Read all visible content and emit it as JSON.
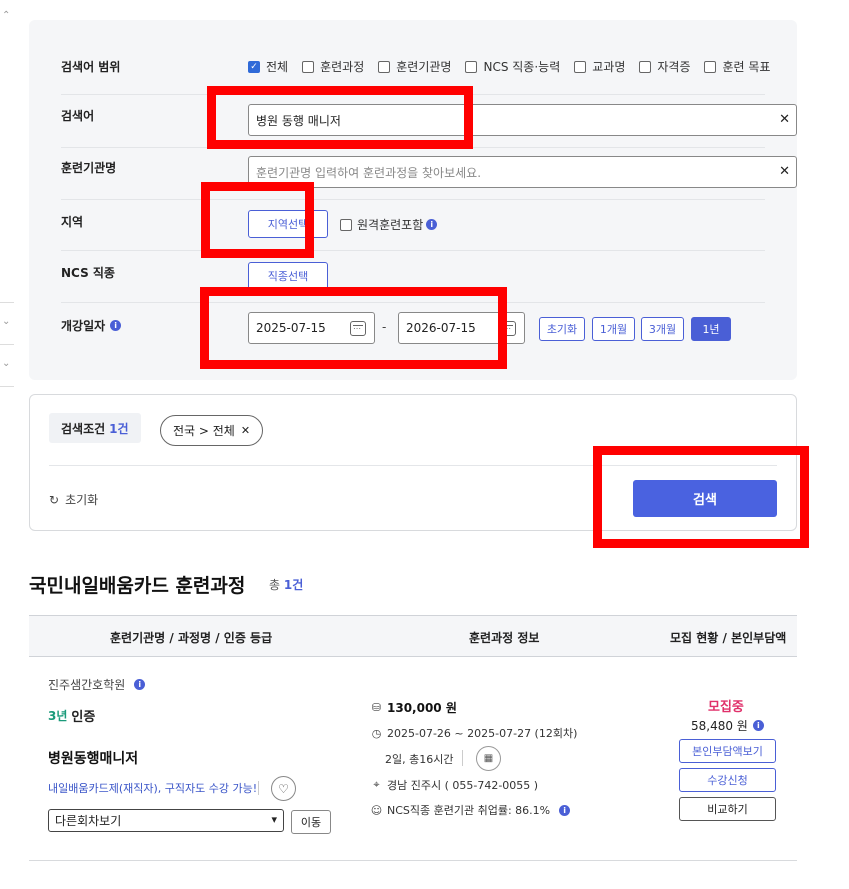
{
  "search": {
    "scope_label": "검색어 범위",
    "scope_options": [
      {
        "label": "전체",
        "checked": true
      },
      {
        "label": "훈련과정",
        "checked": false
      },
      {
        "label": "훈련기관명",
        "checked": false
      },
      {
        "label": "NCS 직종·능력",
        "checked": false
      },
      {
        "label": "교과명",
        "checked": false
      },
      {
        "label": "자격증",
        "checked": false
      },
      {
        "label": "훈련 목표",
        "checked": false
      }
    ],
    "keyword_label": "검색어",
    "keyword_value": "병원 동행 매니저",
    "institution_label": "훈련기관명",
    "institution_placeholder": "훈련기관명 입력하여 훈련과정을 찾아보세요.",
    "region_label": "지역",
    "region_button": "지역선택",
    "remote_label": "원격훈련포함",
    "ncs_label": "NCS 직종",
    "ncs_button": "직종선택",
    "date_label": "개강일자",
    "date_from": "2025-07-15",
    "date_to": "2026-07-15",
    "date_sep": "-",
    "period_buttons": [
      "초기화",
      "1개월",
      "3개월",
      "1년"
    ],
    "active_period": "1년"
  },
  "conditions": {
    "label": "검색조건",
    "count": "1건",
    "chip": "전국 > 전체",
    "reset": "초기화",
    "search_button": "검색"
  },
  "results": {
    "title": "국민내일배움카드 훈련과정",
    "total_prefix": "총",
    "total_count": "1건",
    "columns": [
      "훈련기관명 / 과정명 / 인증 등급",
      "훈련과정 정보",
      "모집 현황 / 본인부담액"
    ],
    "items": [
      {
        "institution": "진주샘간호학원",
        "cert_year": "3년",
        "cert_label": "인증",
        "course_name": "병원동행매니저",
        "tagline": "내일배움카드제(재직자), 구직자도 수강 가능!",
        "session_select": "다른회차보기",
        "move_button": "이동",
        "price": "130,000 원",
        "period": "2025-07-26 ~ 2025-07-27 (12회차)",
        "schedule": "2일, 총16시간",
        "location": "경남 진주시 ( 055-742-0055 )",
        "employment": "NCS직종 훈련기관 취업률: 86.1%",
        "status": "모집중",
        "self_pay": "58,480 원",
        "buttons": [
          "본인부담액보기",
          "수강신청",
          "비교하기"
        ]
      }
    ]
  },
  "icons": {
    "info": "info-icon",
    "reset": "refresh-icon",
    "coin": "coin-icon",
    "clock": "clock-icon",
    "pin": "location-pin-icon",
    "person": "person-icon",
    "heart": "heart-icon",
    "calendar": "calendar-icon"
  },
  "colors": {
    "accent": "#4a5fd6",
    "search_button": "#4a62e0",
    "status": "#e0306a",
    "highlight": "#ff0000"
  }
}
